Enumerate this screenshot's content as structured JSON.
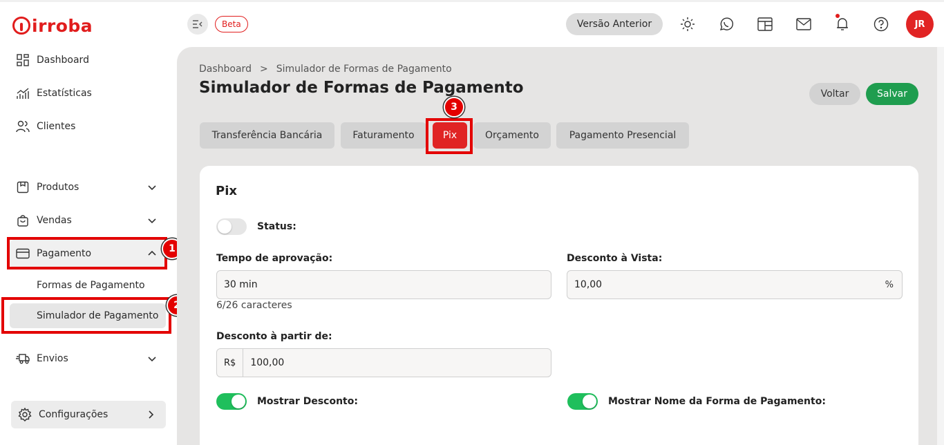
{
  "app": {
    "logo_text": "irroba",
    "beta_label": "Beta",
    "previous_version_label": "Versão Anterior",
    "avatar_initials": "JR"
  },
  "sidebar": {
    "items": [
      {
        "label": "Dashboard",
        "icon": "dashboard-icon"
      },
      {
        "label": "Estatísticas",
        "icon": "chart-icon"
      },
      {
        "label": "Clientes",
        "icon": "users-icon"
      },
      {
        "label": "Produtos",
        "icon": "box-icon"
      },
      {
        "label": "Vendas",
        "icon": "bag-icon"
      },
      {
        "label": "Pagamento",
        "icon": "card-icon"
      },
      {
        "label": "Envios",
        "icon": "truck-icon"
      }
    ],
    "payment_sub": [
      "Formas de Pagamento",
      "Simulador de Pagamento"
    ],
    "config_label": "Configurações"
  },
  "annotations": {
    "badge1": "1",
    "badge2": "2",
    "badge3": "3",
    "color": "#e30000"
  },
  "main": {
    "breadcrumb": [
      "Dashboard",
      ">",
      "Simulador de Formas de Pagamento"
    ],
    "title": "Simulador de Formas de Pagamento",
    "back_label": "Voltar",
    "save_label": "Salvar",
    "tabs": [
      {
        "label": "Transferência Bancária",
        "active": false
      },
      {
        "label": "Faturamento",
        "active": false
      },
      {
        "label": "Pix",
        "active": true
      },
      {
        "label": "Orçamento",
        "active": false
      },
      {
        "label": "Pagamento Presencial",
        "active": false
      }
    ]
  },
  "form": {
    "section_title": "Pix",
    "status_label": "Status:",
    "status_on": false,
    "approval_time": {
      "label": "Tempo de aprovação:",
      "value": "30 min",
      "helper": "6/26 caracteres"
    },
    "cash_discount": {
      "label": "Desconto à Vista:",
      "value": "10,00",
      "suffix": "%"
    },
    "discount_from": {
      "label": "Desconto à partir de:",
      "prefix": "R$",
      "value": "100,00"
    },
    "show_discount": {
      "label": "Mostrar Desconto:",
      "on": true
    },
    "show_method_name": {
      "label": "Mostrar Nome da Forma de Pagamento:",
      "on": true
    }
  },
  "colors": {
    "brand_red": "#e11d1d",
    "save_green": "#1f9d4f",
    "switch_green": "#1fbf5c"
  }
}
